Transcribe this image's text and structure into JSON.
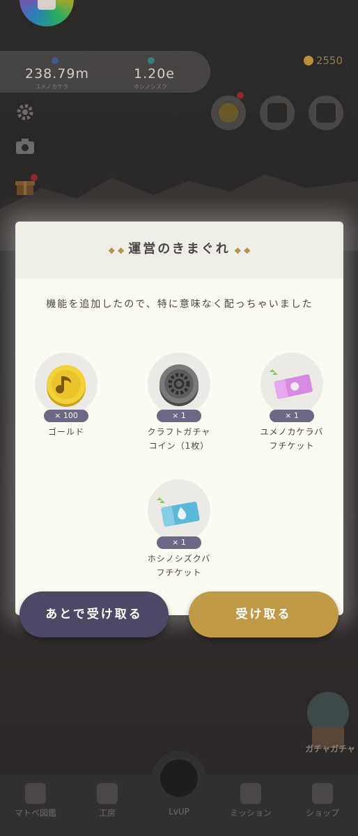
{
  "hud": {
    "stat1_value": "238.79m",
    "stat1_sub": "ユメノカケラ",
    "stat2_value": "1.20e",
    "stat2_sub": "ホシノシズク",
    "gold": "2550"
  },
  "dialog": {
    "title": "運営のきまぐれ",
    "message": "機能を追加したので、特に意味なく配っちゃいました",
    "items": [
      {
        "qty": "× 100",
        "name": "ゴールド",
        "icon": "gold-coin-icon"
      },
      {
        "qty": "× 1",
        "name": "クラフトガチャコイン（1枚）",
        "icon": "gear-coin-icon"
      },
      {
        "qty": "× 1",
        "name": "ユメノカケラバフチケット",
        "icon": "pink-ticket-icon"
      },
      {
        "qty": "× 1",
        "name": "ホシノシズクバフチケット",
        "icon": "blue-ticket-icon"
      }
    ]
  },
  "buttons": {
    "later": "あとで受け取る",
    "receive": "受け取る"
  },
  "side": {
    "gacha_label": "ガチャガチャ"
  },
  "nav": {
    "items": [
      "マトペ図鑑",
      "工房",
      "LvUP",
      "ミッション",
      "ショップ"
    ]
  },
  "colors": {
    "accent_gold": "#c09a46",
    "accent_purple": "#4d4865",
    "badge_purple": "#6d6685"
  }
}
